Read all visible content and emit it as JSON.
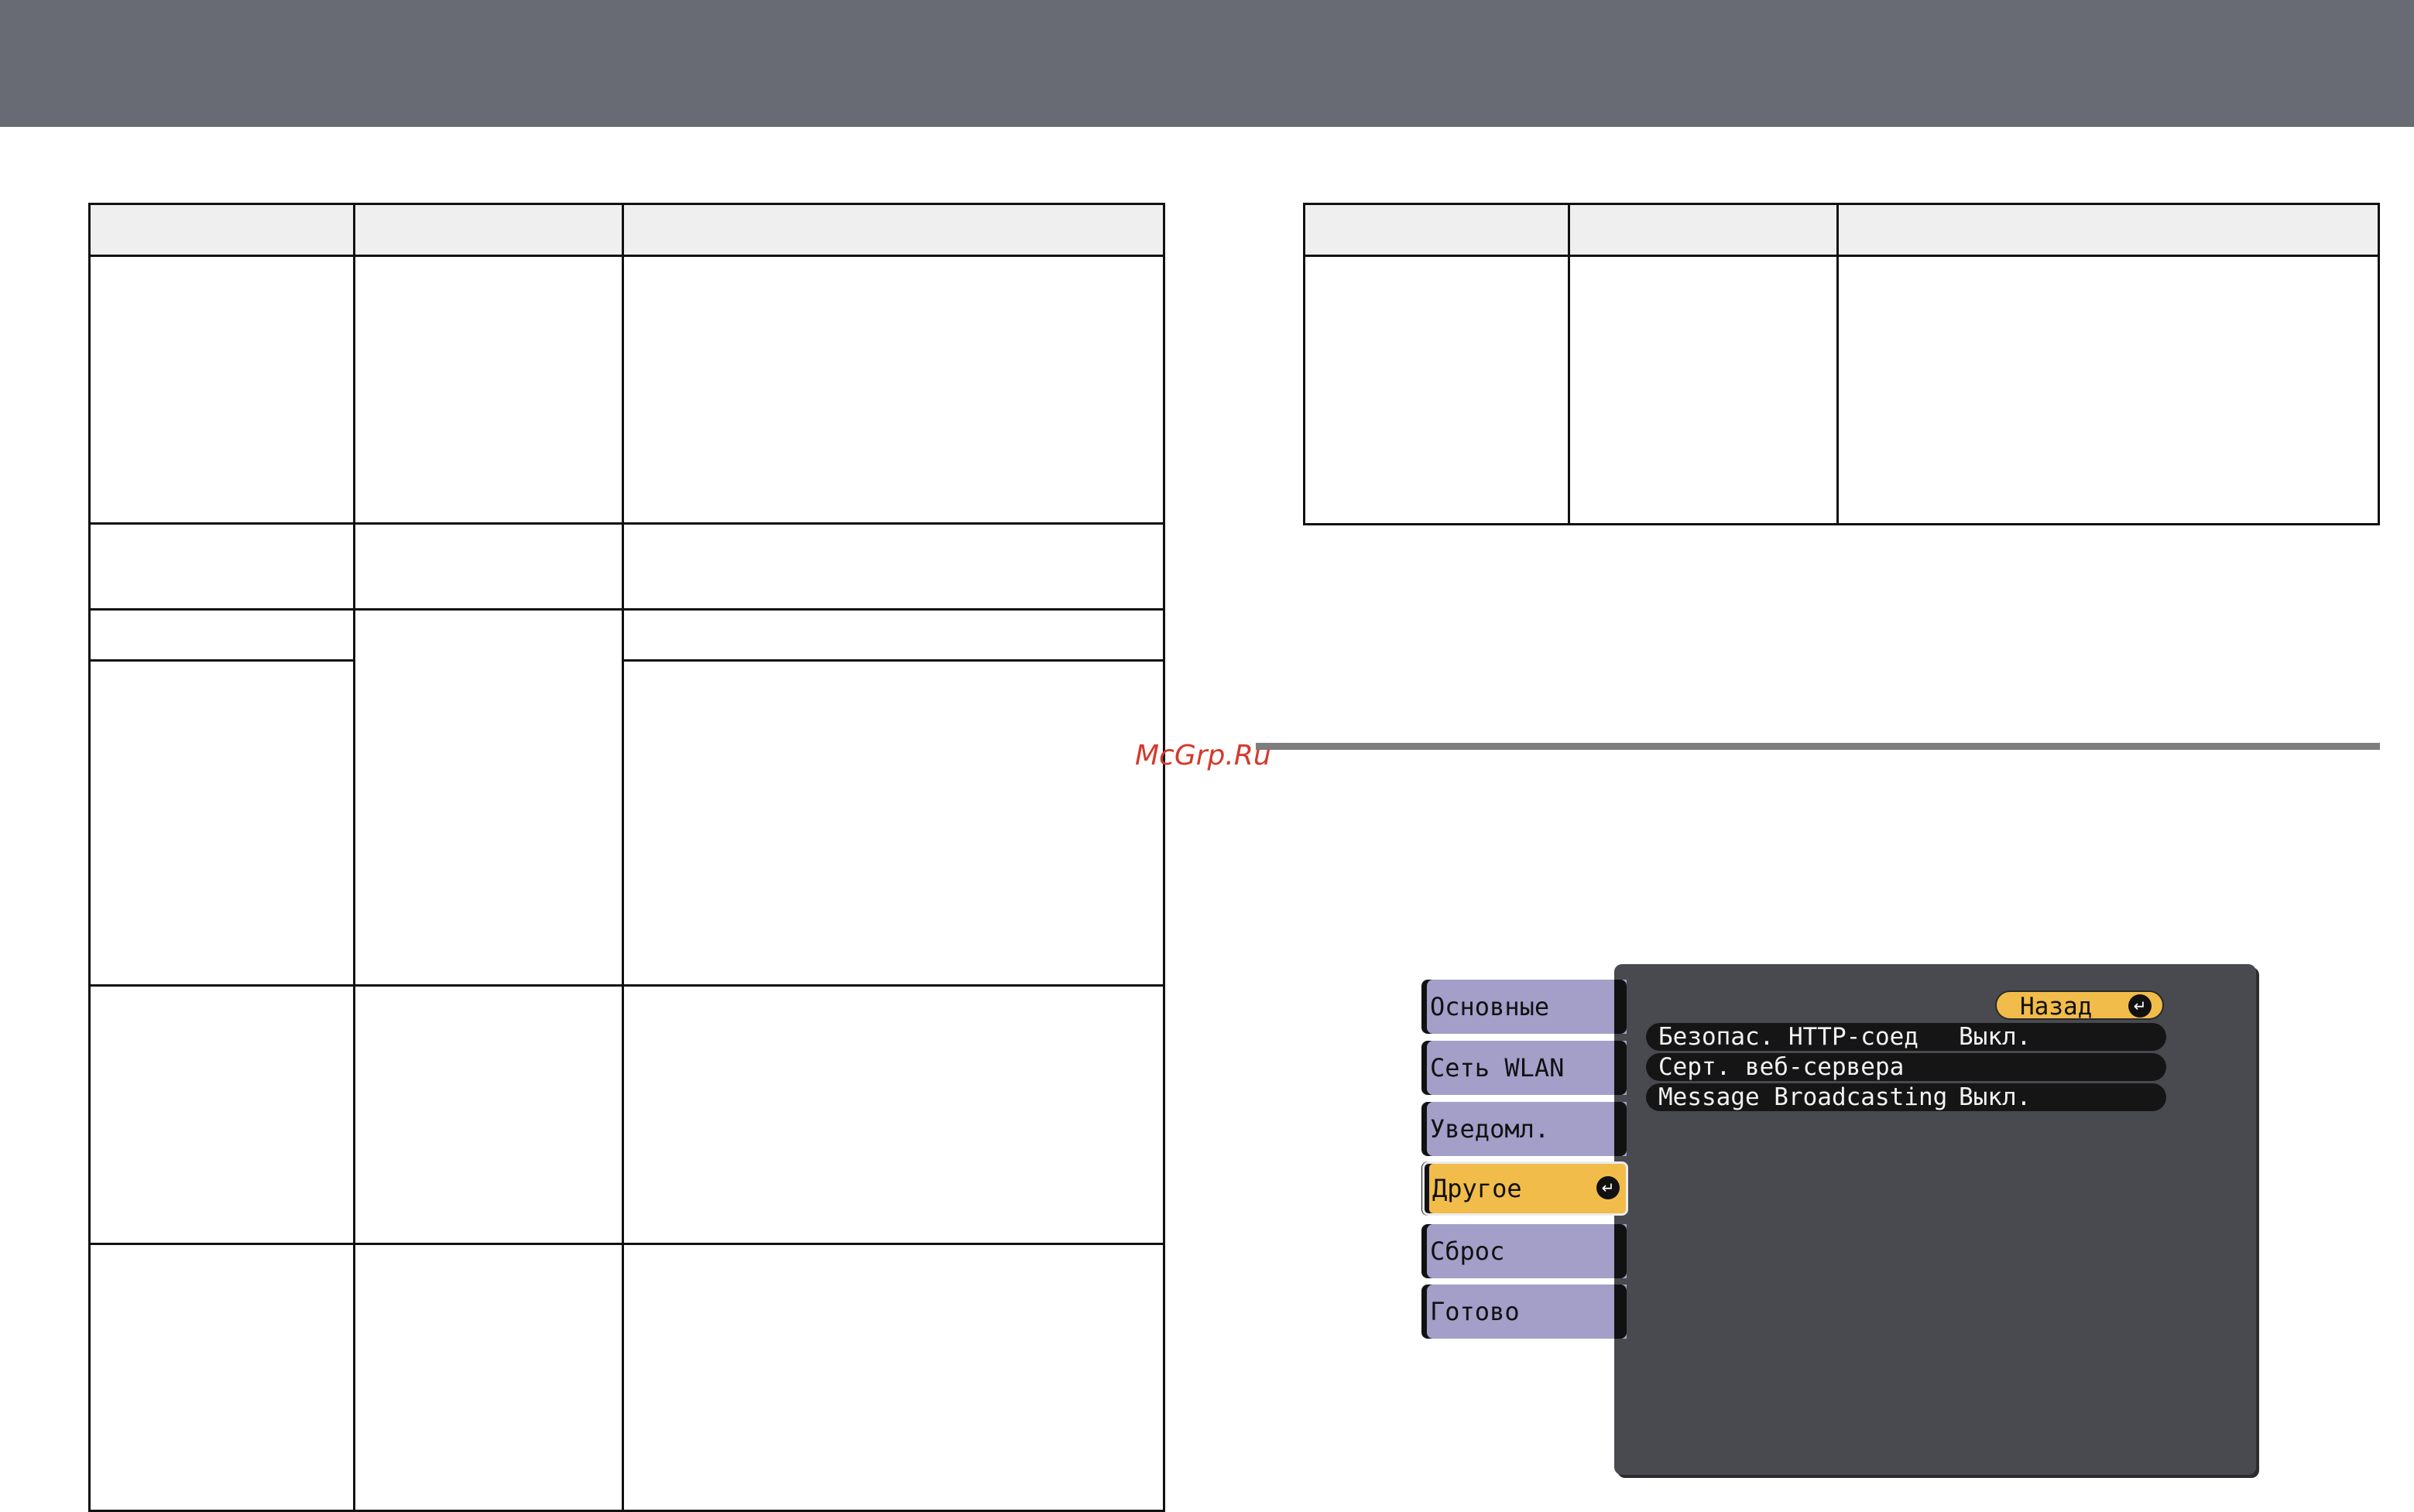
{
  "watermark": "McGrp.Ru",
  "osd_menu": {
    "tabs": [
      {
        "label": "Основные"
      },
      {
        "label": "Сеть WLAN"
      },
      {
        "label": "Уведомл."
      },
      {
        "label": "Другое",
        "active": true
      },
      {
        "label": "Сброс"
      },
      {
        "label": "Готово"
      }
    ],
    "back_label": "Назад",
    "rows": [
      {
        "label": "Безопас. HTTP-соед",
        "value": "Выкл."
      },
      {
        "label": "Серт. веб-сервера",
        "value": ""
      },
      {
        "label": "Message Broadcasting",
        "value": "Выкл."
      }
    ],
    "colors": {
      "tab": "#a39fc9",
      "active_tab": "#f1bc4a",
      "panel": "#494a50",
      "row": "#151515"
    },
    "enter_icon": "enter-icon"
  }
}
